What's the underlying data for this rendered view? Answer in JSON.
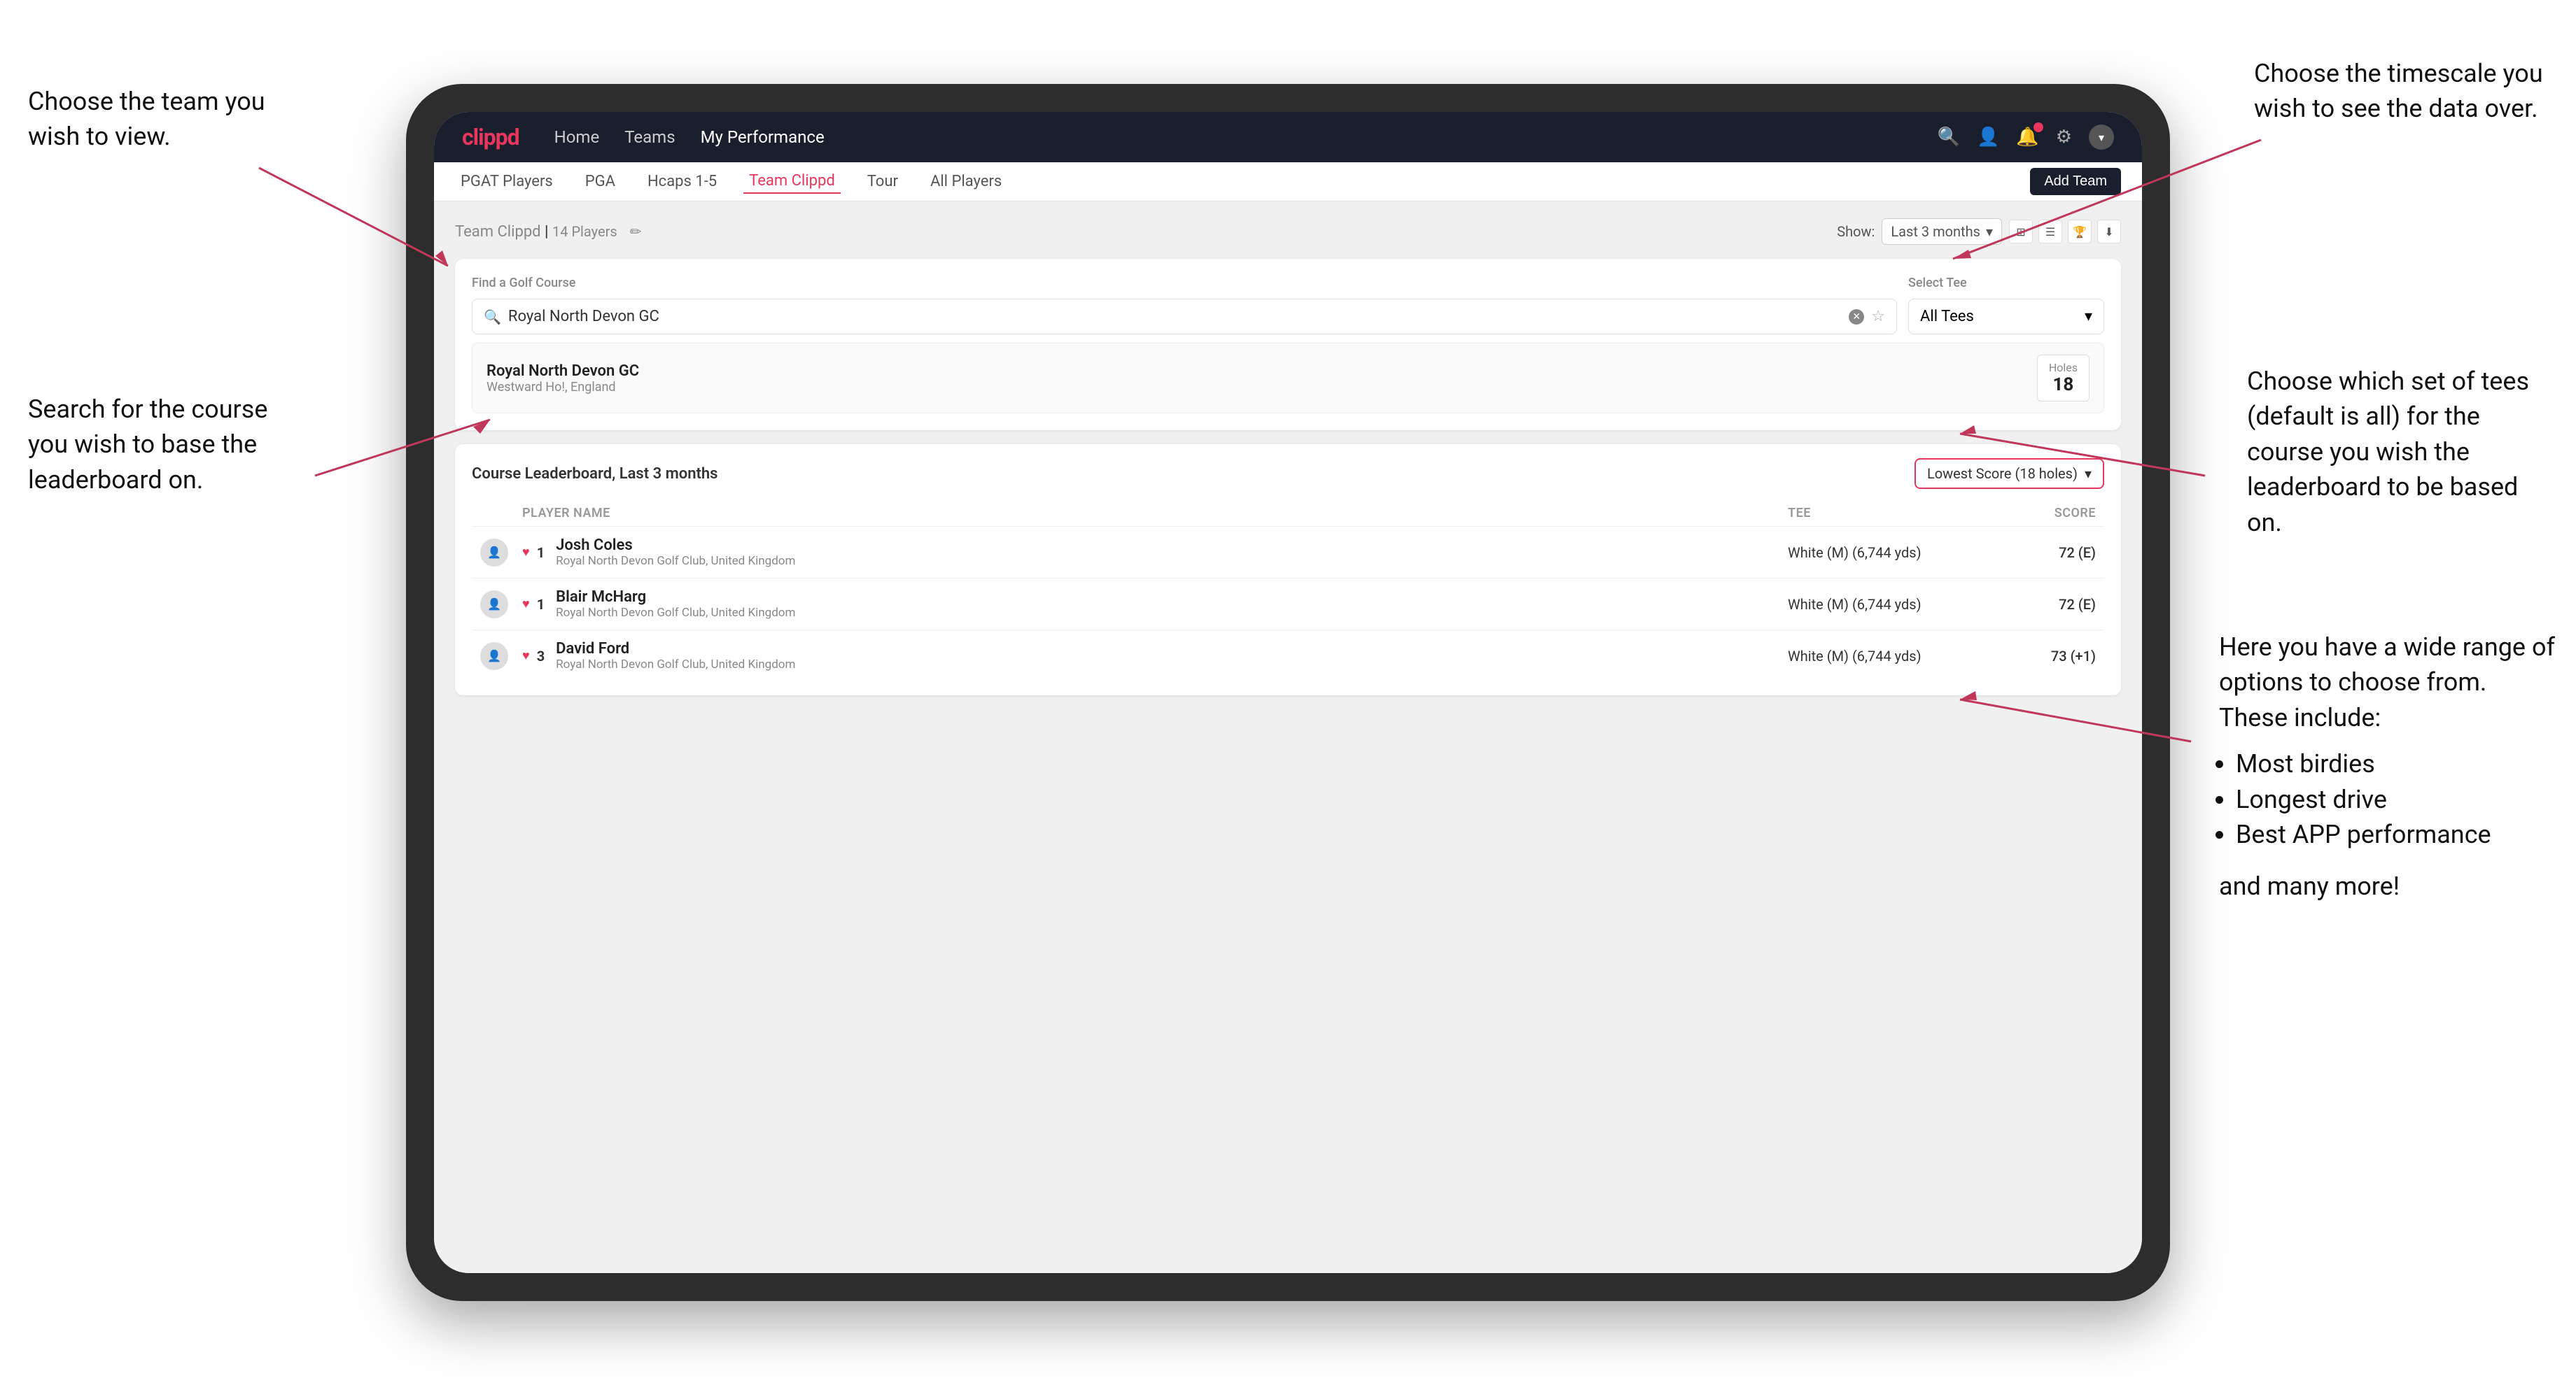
{
  "annotations": {
    "top_left": {
      "title": "Choose the team you wish to view."
    },
    "top_right": {
      "title": "Choose the timescale you wish to see the data over."
    },
    "mid_right": {
      "title": "Choose which set of tees (default is all) for the course you wish the leaderboard to be based on."
    },
    "mid_left": {
      "title": "Search for the course you wish to base the leaderboard on."
    },
    "bottom_right": {
      "title": "Here you have a wide range of options to choose from. These include:",
      "bullets": [
        "Most birdies",
        "Longest drive",
        "Best APP performance"
      ],
      "extra": "and many more!"
    }
  },
  "navbar": {
    "logo": "clippd",
    "nav_items": [
      "Home",
      "Teams",
      "My Performance"
    ],
    "active_nav": "My Performance"
  },
  "subnav": {
    "items": [
      "PGAT Players",
      "PGA",
      "Hcaps 1-5",
      "Team Clippd",
      "Tour",
      "All Players"
    ],
    "active_item": "Team Clippd",
    "add_btn": "Add Team"
  },
  "team_header": {
    "title": "Team Clippd",
    "player_count": "14 Players",
    "show_label": "Show:",
    "show_value": "Last 3 months"
  },
  "course_search": {
    "find_label": "Find a Golf Course",
    "search_value": "Royal North Devon GC",
    "select_tee_label": "Select Tee",
    "tee_value": "All Tees"
  },
  "course_result": {
    "name": "Royal North Devon GC",
    "location": "Westward Ho!, England",
    "holes_label": "Holes",
    "holes_value": "18"
  },
  "leaderboard": {
    "title": "Course Leaderboard,",
    "period": "Last 3 months",
    "score_type": "Lowest Score (18 holes)",
    "columns": [
      "PLAYER NAME",
      "TEE",
      "SCORE"
    ],
    "rows": [
      {
        "rank": "1",
        "name": "Josh Coles",
        "club": "Royal North Devon Golf Club, United Kingdom",
        "tee": "White (M) (6,744 yds)",
        "score": "72 (E)"
      },
      {
        "rank": "1",
        "name": "Blair McHarg",
        "club": "Royal North Devon Golf Club, United Kingdom",
        "tee": "White (M) (6,744 yds)",
        "score": "72 (E)"
      },
      {
        "rank": "3",
        "name": "David Ford",
        "club": "Royal North Devon Golf Club, United Kingdom",
        "tee": "White (M) (6,744 yds)",
        "score": "73 (+1)"
      }
    ]
  }
}
